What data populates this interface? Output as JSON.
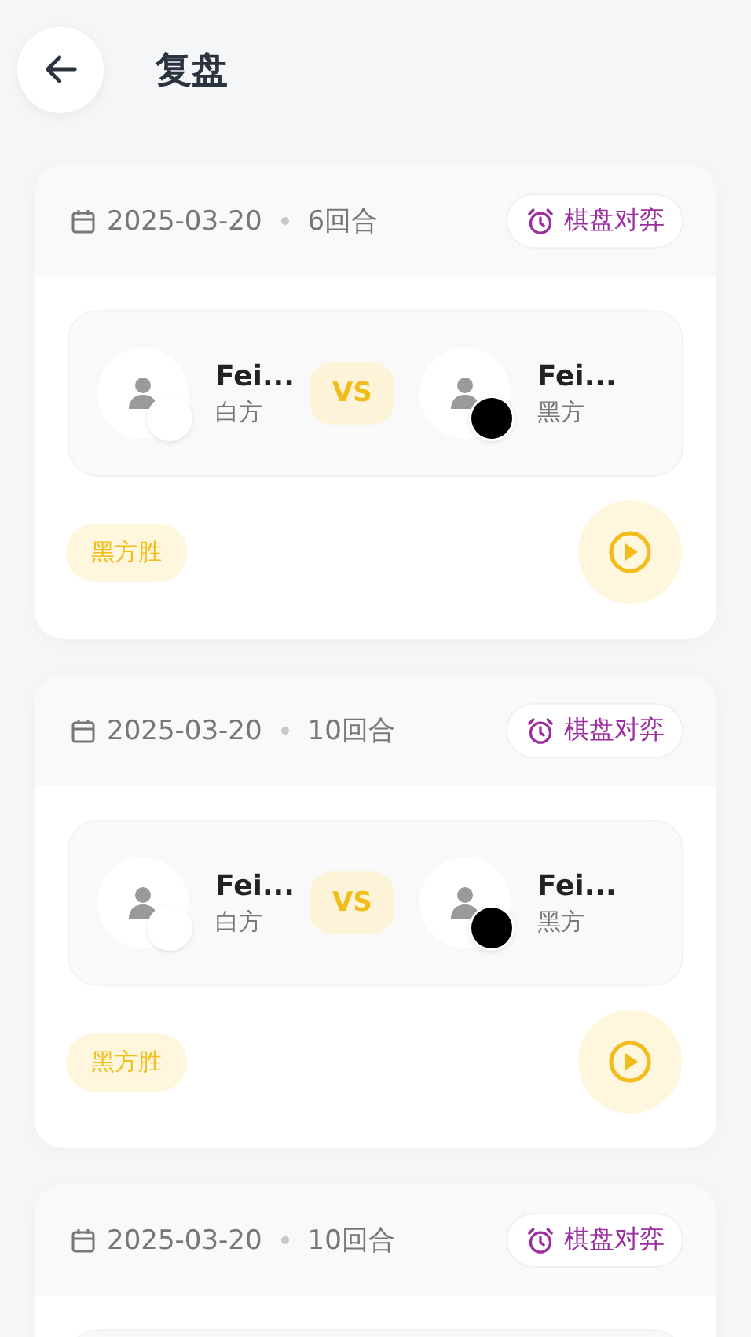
{
  "header": {
    "title": "复盘"
  },
  "games": [
    {
      "date": "2025-03-20",
      "rounds": "6回合",
      "mode": "棋盘对弈",
      "players": [
        {
          "name": "Fei...",
          "side": "白方",
          "color": "#ffffff"
        },
        {
          "name": "Fei...",
          "side": "黑方",
          "color": "#000000"
        }
      ],
      "vs": "VS",
      "result": "黑方胜"
    },
    {
      "date": "2025-03-20",
      "rounds": "10回合",
      "mode": "棋盘对弈",
      "players": [
        {
          "name": "Fei...",
          "side": "白方",
          "color": "#ffffff"
        },
        {
          "name": "Fei...",
          "side": "黑方",
          "color": "#000000"
        }
      ],
      "vs": "VS",
      "result": "黑方胜"
    },
    {
      "date": "2025-03-20",
      "rounds": "10回合",
      "mode": "棋盘对弈"
    }
  ]
}
